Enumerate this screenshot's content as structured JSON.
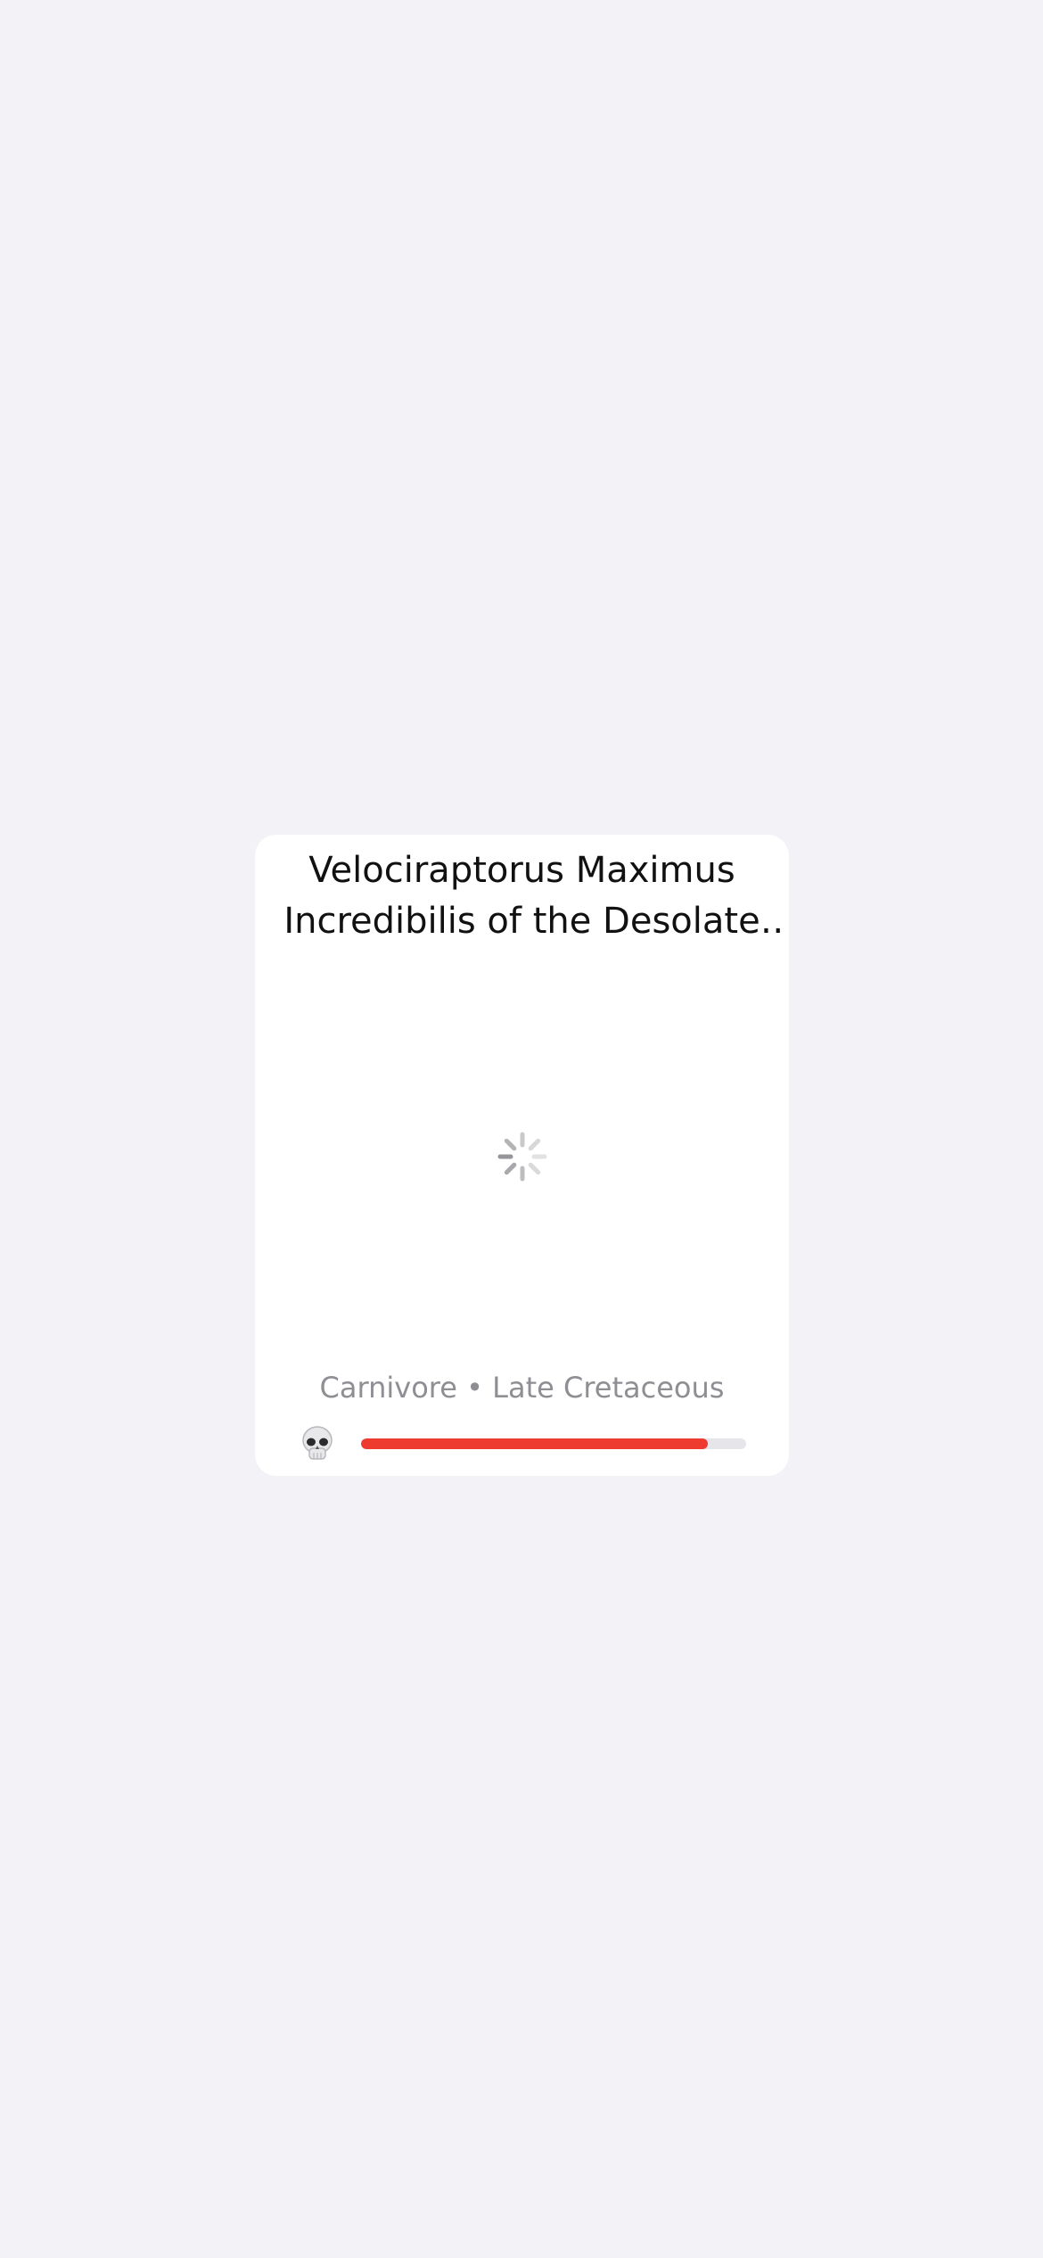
{
  "card": {
    "title": "Velociraptorus Maximus Incredibilis of the Desolate E…",
    "loading_icon": "activity-spinner-icon",
    "meta": "Carnivore • Late Cretaceous",
    "danger_icon": "skull-icon",
    "danger_level": 0.9,
    "danger_color": "#ee3b30"
  }
}
